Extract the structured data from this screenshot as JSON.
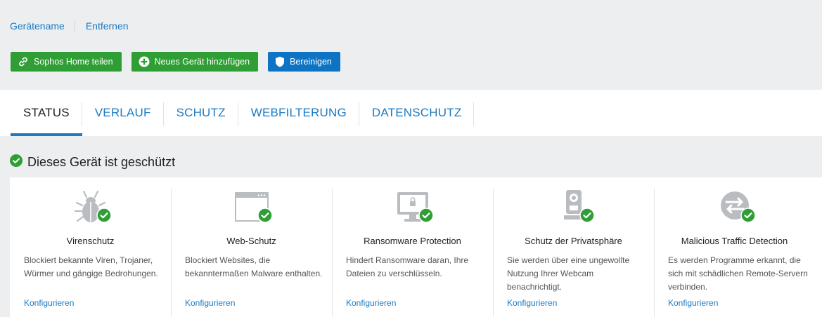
{
  "toplinks": {
    "device_name": "Gerätename",
    "remove": "Entfernen"
  },
  "actions": {
    "share": "Sophos Home teilen",
    "add_device": "Neues Gerät hinzufügen",
    "clean": "Bereinigen"
  },
  "tabs": [
    "STATUS",
    "VERLAUF",
    "SCHUTZ",
    "WEBFILTERUNG",
    "DATENSCHUTZ"
  ],
  "active_tab": "STATUS",
  "status": {
    "heading": "Dieses Gerät ist geschützt"
  },
  "cards": [
    {
      "title": "Virenschutz",
      "desc": "Blockiert bekannte Viren, Trojaner, Würmer und gängige Bedrohungen.",
      "link": "Konfigurieren",
      "icon": "bug-icon"
    },
    {
      "title": "Web-Schutz",
      "desc": "Blockiert Websites, die bekanntermaßen Malware enthalten.",
      "link": "Konfigurieren",
      "icon": "browser-window-icon"
    },
    {
      "title": "Ransomware Protection",
      "desc": "Hindert Ransomware daran, Ihre Dateien zu verschlüsseln.",
      "link": "Konfigurieren",
      "icon": "locked-monitor-icon"
    },
    {
      "title": "Schutz der Privatsphäre",
      "desc": "Sie werden über eine ungewollte Nutzung Ihrer Webcam benachrichtigt.",
      "link": "Konfigurieren",
      "icon": "webcam-icon"
    },
    {
      "title": "Malicious Traffic Detection",
      "desc": "Es werden Programme erkannt, die sich mit schädlichen Remote-Servern verbinden.",
      "link": "Konfigurieren",
      "icon": "traffic-arrows-icon"
    }
  ],
  "colors": {
    "link_blue": "#1a7bc4",
    "green": "#2f9e34",
    "blue_button": "#0d73c2",
    "background": "#eceef0"
  }
}
